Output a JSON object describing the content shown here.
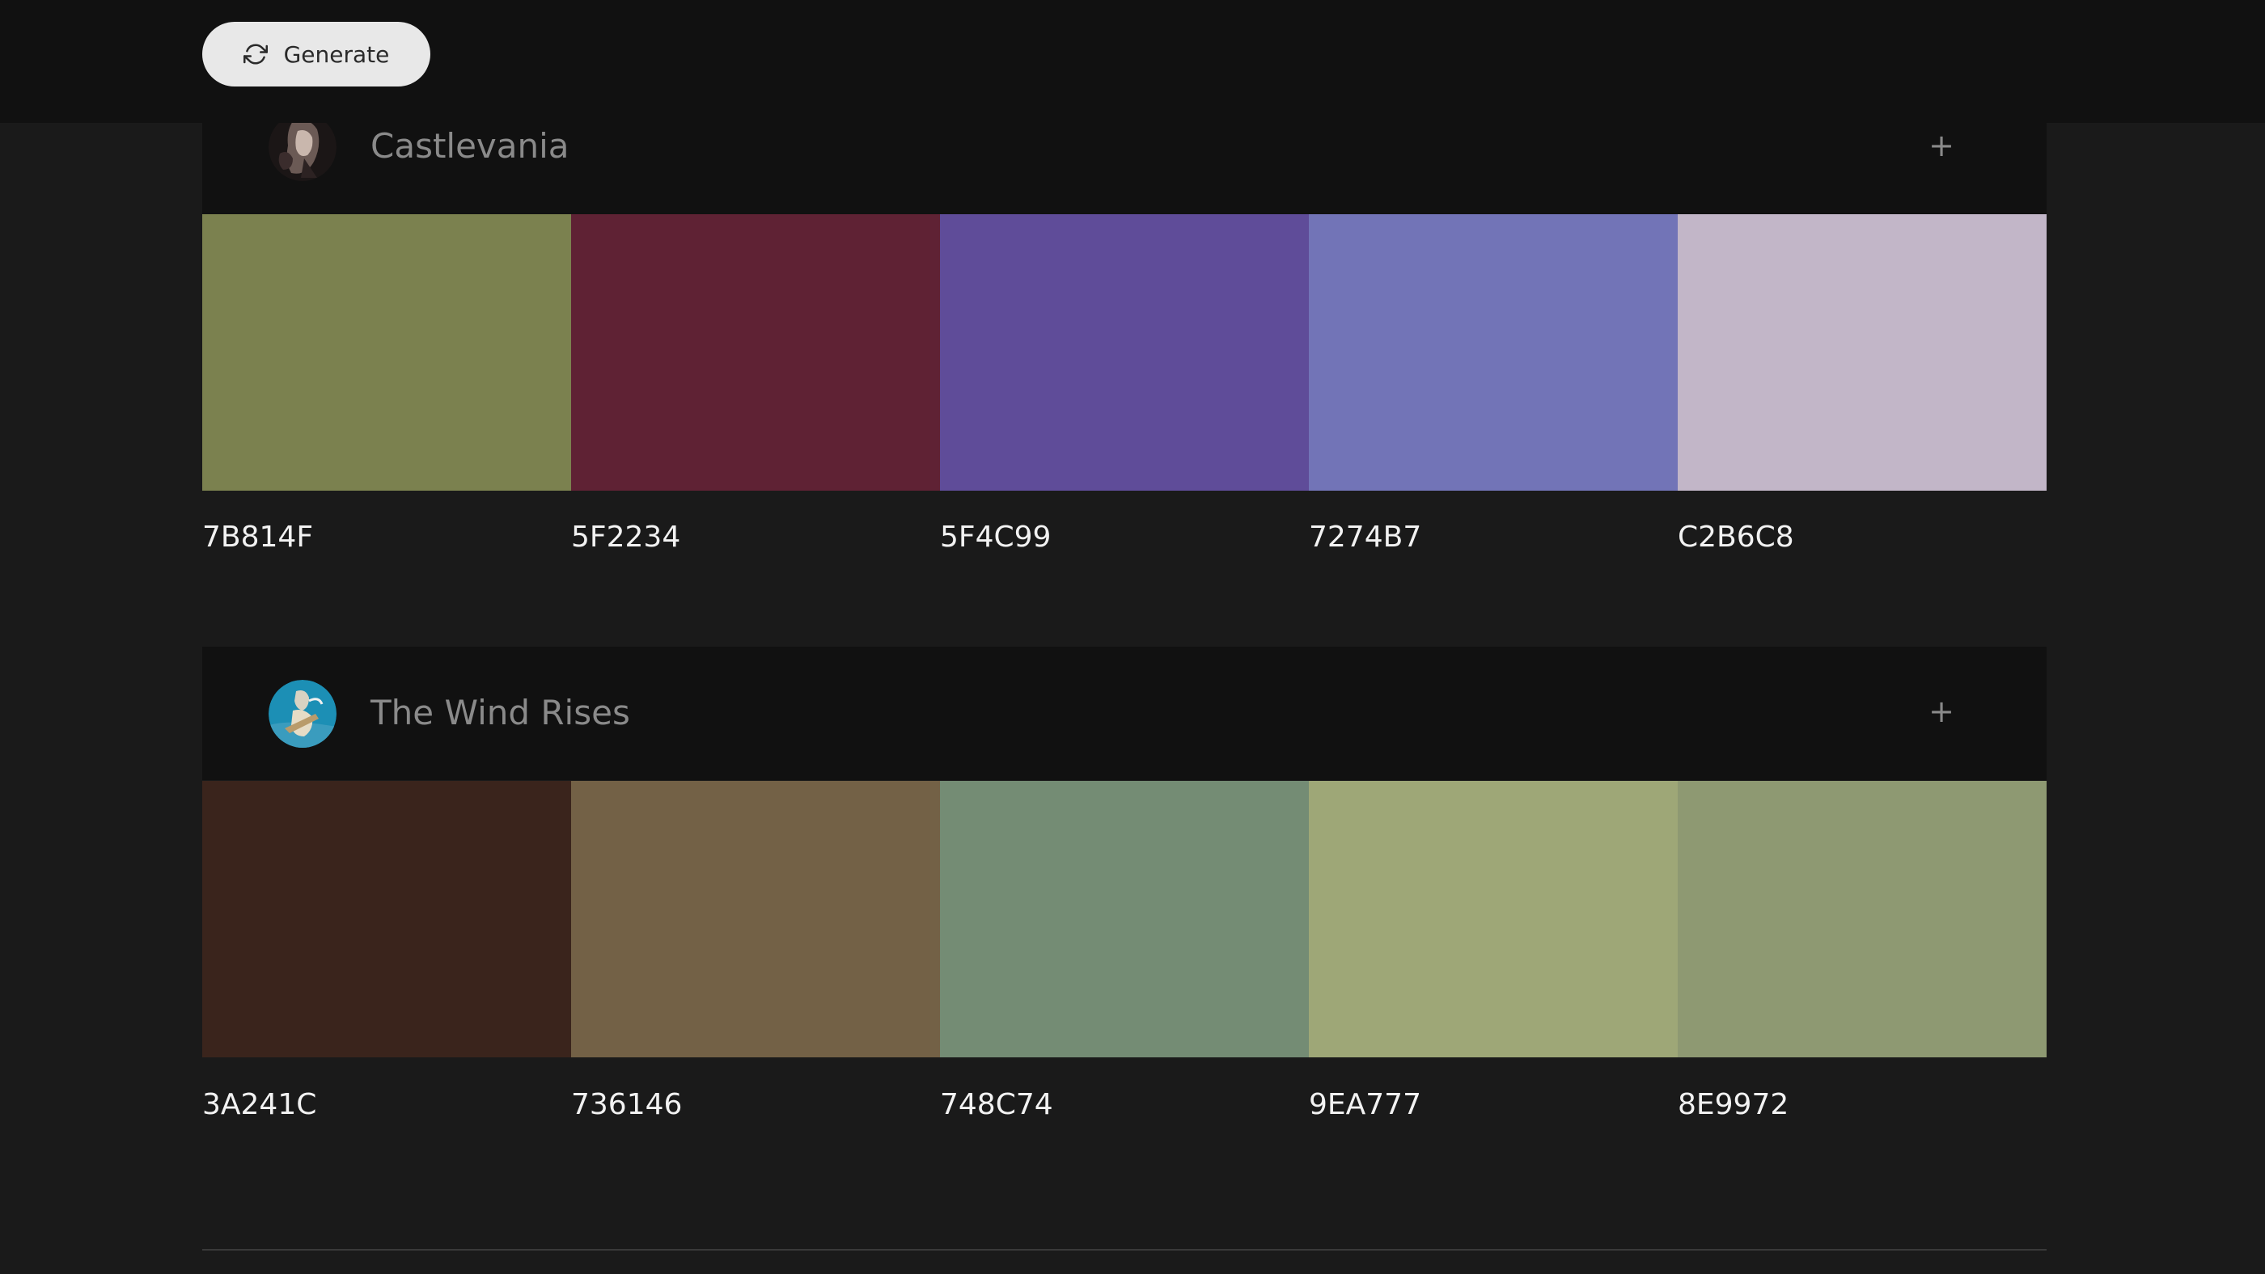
{
  "toolbar": {
    "generate_label": "Generate"
  },
  "palettes": [
    {
      "title": "Castlevania",
      "add_label": "+",
      "colors": [
        {
          "hex": "7B814F",
          "color": "#7B814F"
        },
        {
          "hex": "5F2234",
          "color": "#5F2234"
        },
        {
          "hex": "5F4C99",
          "color": "#5F4C99"
        },
        {
          "hex": "7274B7",
          "color": "#7274B7"
        },
        {
          "hex": "C2B6C8",
          "color": "#C2B6C8"
        }
      ]
    },
    {
      "title": "The Wind Rises",
      "add_label": "+",
      "colors": [
        {
          "hex": "3A241C",
          "color": "#3A241C"
        },
        {
          "hex": "736146",
          "color": "#736146"
        },
        {
          "hex": "748C74",
          "color": "#748C74"
        },
        {
          "hex": "9EA777",
          "color": "#9EA777"
        },
        {
          "hex": "8E9972",
          "color": "#8E9972"
        }
      ]
    }
  ]
}
